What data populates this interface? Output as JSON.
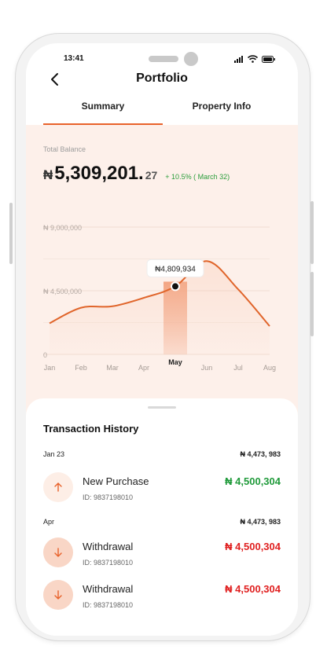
{
  "status_bar": {
    "time": "13:41"
  },
  "header": {
    "title": "Portfolio"
  },
  "tabs": [
    {
      "label": "Summary",
      "active": true
    },
    {
      "label": "Property Info",
      "active": false
    }
  ],
  "portfolio": {
    "total_balance_label": "Total Balance",
    "currency_symbol": "₦",
    "amount_main": "5,309,201.",
    "amount_cents": "27",
    "change_text": "+ 10.5% ( March 32)"
  },
  "chart_data": {
    "type": "area",
    "categories": [
      "Jan",
      "Feb",
      "Mar",
      "Apr",
      "May",
      "Jun",
      "Jul",
      "Aug"
    ],
    "y_tick_labels": [
      "₦ 9,000,000",
      "₦ 4,500,000",
      "0"
    ],
    "ylim": [
      0,
      9000000
    ],
    "series": [
      {
        "values": [
          2200000,
          3300000,
          3400000,
          4000000,
          4809934,
          6600000,
          4600000,
          2000000
        ]
      }
    ],
    "highlight": {
      "category": "May",
      "value_label": "₦4,809,934"
    },
    "grid": true,
    "colors": {
      "line": "#e0652b",
      "area": "#f8c2a8",
      "highlight_band": "#f3a583"
    }
  },
  "transactions": {
    "title": "Transaction History",
    "groups": [
      {
        "label": "Jan 23",
        "total": "₦ 4,473, 983",
        "items": [
          {
            "name": "New Purchase",
            "id": "ID: 9837198010",
            "amount": "₦ 4,500,304",
            "direction": "up"
          }
        ]
      },
      {
        "label": "Apr",
        "total": "₦ 4,473, 983",
        "items": [
          {
            "name": "Withdrawal",
            "id": "ID: 9837198010",
            "amount": "₦ 4,500,304",
            "direction": "down"
          },
          {
            "name": "Withdrawal",
            "id": "ID: 9837198010",
            "amount": "₦ 4,500,304",
            "direction": "down"
          }
        ]
      }
    ]
  },
  "colors": {
    "accent": "#e8622b",
    "positive": "#1f9a3a",
    "negative": "#e02020",
    "card_bg": "#fdf0ea"
  }
}
